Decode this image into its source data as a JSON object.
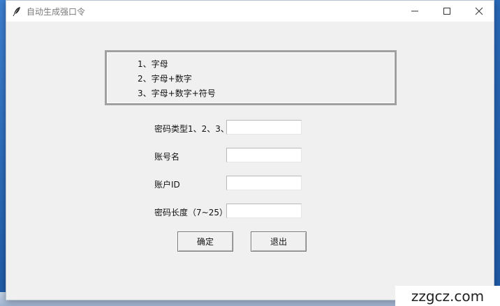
{
  "window": {
    "title": "自动生成强口令",
    "controls": {
      "minimize": "minimize-icon",
      "maximize": "maximize-icon",
      "close": "close-icon"
    }
  },
  "options_list": {
    "items": [
      "1、字母",
      "2、字母+数字",
      "3、字母+数字+符号"
    ]
  },
  "form": {
    "fields": [
      {
        "label": "密码类型1、2、3、",
        "value": ""
      },
      {
        "label": "账号名",
        "value": ""
      },
      {
        "label": "账户ID",
        "value": ""
      },
      {
        "label": "密码长度（7~25）",
        "value": ""
      }
    ]
  },
  "buttons": {
    "ok": "确定",
    "quit": "退出"
  },
  "watermark": "zzgcz.com"
}
